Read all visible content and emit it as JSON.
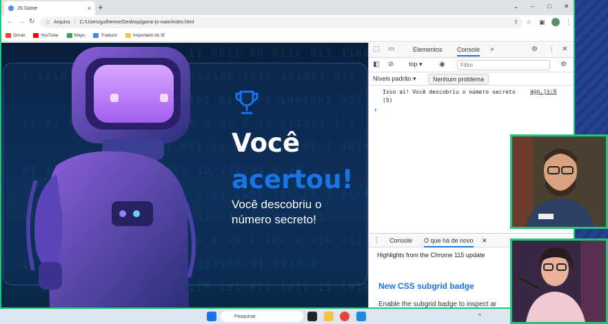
{
  "browser": {
    "tab_title": "JS Game",
    "tab_close": "×",
    "new_tab": "+",
    "window_controls": [
      "⌄",
      "–",
      "□",
      "✕"
    ],
    "address_prefix": "Arquivo",
    "address_url": "C:/Users/guilherme/Desktop/game-js-main/index.html",
    "bookmarks": [
      "Gmail",
      "YouTube",
      "Maps",
      "Traduzir",
      "Importado do IE"
    ]
  },
  "page": {
    "binary_rows": [
      "0 110 0110 11 0011 00 0110 011 1100 0110",
      "1 1110 0110 0 1011 01 010100 1011 101001 010",
      "10010 011 1101 01 0101 1001001 011 1 0 0",
      "11 01 110 010 101 1 000 0 00 0 10 011011 1 1",
      "1101011 1 011 00 011 10 1101 1 00101 01",
      "01 110 010 01 001 1100 10 110101 0 00",
      "10 0100 011 0 01 1100 110 10 1 01001 1",
      "0110011 1 11 0 1 0 101 11 01 100 010 011",
      "110 10 10 010 0 10 1 101 0 010 111 0011",
      "10100 010 11 101110100 101100 01 0110 0",
      "0110 1000 0110 101 011 1011 11 1010 0100"
    ],
    "title_line1": "Você",
    "title_line2": "acertou!",
    "subtitle": "Você descobriu o número secreto!"
  },
  "devtools": {
    "tabs": [
      "Elementos",
      "Console"
    ],
    "more_tabs": "»",
    "context": "top",
    "filter_placeholder": "Filtro",
    "levels": "Níveis padrão",
    "issues": "Nenhum problema",
    "log_message": "Isso ai! Você descobriu o número secreto (5)",
    "log_source": "app.js:6",
    "prompt": "›",
    "drawer_tabs": [
      "Console",
      "O que há de novo"
    ],
    "drawer_close": "✕",
    "highlights": "Highlights from the Chrome 115 update",
    "new_css": "New CSS subgrid badge",
    "enable_text": "Enable the subgrid badge to inspect ar"
  },
  "taskbar": {
    "search": "Pesquisar"
  },
  "colors": {
    "accent_green": "#21c47a",
    "title_blue": "#1875e8",
    "devtools_blue": "#1a73e8"
  }
}
